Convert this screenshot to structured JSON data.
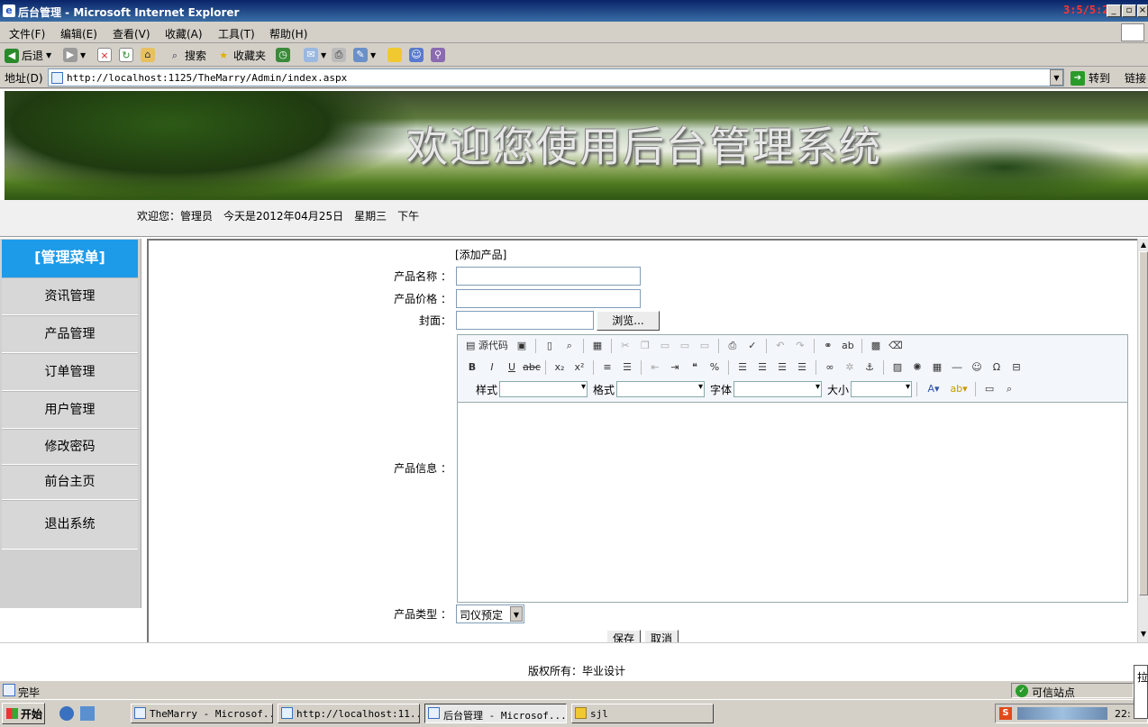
{
  "window": {
    "title": "后台管理 - Microsoft Internet Explorer",
    "clock": "3:5/5:27"
  },
  "menubar": [
    "文件(F)",
    "编辑(E)",
    "查看(V)",
    "收藏(A)",
    "工具(T)",
    "帮助(H)"
  ],
  "toolbar": {
    "back": "后退",
    "search": "搜索",
    "favorites": "收藏夹"
  },
  "addressbar": {
    "label": "地址(D)",
    "url": "http://localhost:1125/TheMarry/Admin/index.aspx",
    "go": "转到",
    "links": "链接"
  },
  "banner": {
    "welcome": "欢迎您使用后台管理系统"
  },
  "infobar": {
    "text": "欢迎您：管理员　今天是2012年04月25日　星期三　下午"
  },
  "sidebar": {
    "header": "[管理菜单]",
    "items": [
      "资讯管理",
      "产品管理",
      "订单管理",
      "用户管理",
      "修改密码",
      "前台主页",
      "退出系统"
    ]
  },
  "form": {
    "heading": "[添加产品]",
    "name_label": "产品名称 ：",
    "name_value": "",
    "price_label": "产品价格 ：",
    "price_value": "",
    "cover_label": "封面：",
    "cover_value": "",
    "browse": "浏览...",
    "info_label": "产品信息 ：",
    "type_label": "产品类型 ：",
    "type_selected": "司仪预定",
    "save": "保存",
    "cancel": "取消"
  },
  "editor": {
    "source": "源代码",
    "style_label": "样式",
    "format_label": "格式",
    "font_label": "字体",
    "size_label": "大小"
  },
  "footer": {
    "copyright": "版权所有：毕业设计"
  },
  "statusbar": {
    "status": "完毕",
    "zone": "可信站点"
  },
  "taskbar": {
    "start": "开始",
    "tasks": [
      "TheMarry - Microsof...",
      "http://localhost:11...",
      "后台管理 - Microsof...",
      "sjl"
    ],
    "time": "22:"
  },
  "ime": "拉"
}
